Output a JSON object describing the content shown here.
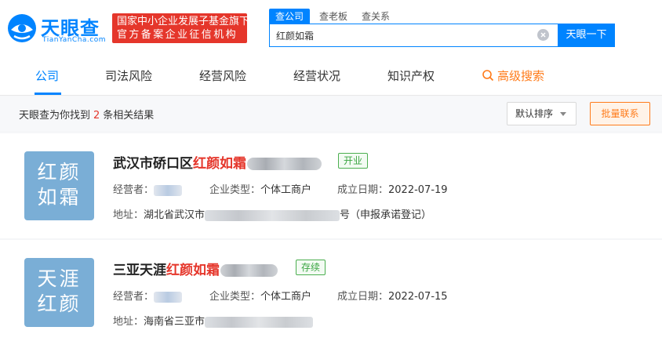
{
  "header": {
    "logo_cn": "天眼查",
    "logo_en": "TianYanCha.com",
    "badge_line1": "国家中小企业发展子基金旗下",
    "badge_line2": "官方备案企业征信机构",
    "search_tabs": [
      "查公司",
      "查老板",
      "查关系"
    ],
    "search_value": "红颜如霜",
    "search_button": "天眼一下"
  },
  "nav": {
    "items": [
      "公司",
      "司法风险",
      "经营风险",
      "经营状况",
      "知识产权"
    ],
    "advanced": "高级搜索"
  },
  "results": {
    "prefix": "天眼查为你找到",
    "count": "2",
    "suffix": "条相关结果",
    "sort_label": "默认排序",
    "batch_label": "批量联系"
  },
  "companies": [
    {
      "avatar_line1": "红颜",
      "avatar_line2": "如霜",
      "name_prefix": "武汉市硚口区",
      "name_highlight": "红颜如霜",
      "status": "开业",
      "operator_label": "经营者：",
      "type_label": "企业类型：",
      "type_value": "个体工商户",
      "date_label": "成立日期：",
      "date_value": "2022-07-19",
      "address_label": "地址：",
      "address_value": "湖北省武汉市",
      "address_suffix": "号（申报承诺登记）"
    },
    {
      "avatar_line1": "天涯",
      "avatar_line2": "红颜",
      "name_prefix": "三亚天涯",
      "name_highlight": "红颜如霜",
      "status": "存续",
      "operator_label": "经营者：",
      "type_label": "企业类型：",
      "type_value": "个体工商户",
      "date_label": "成立日期：",
      "date_value": "2022-07-15",
      "address_label": "地址：",
      "address_value": "海南省三亚市",
      "address_suffix": ""
    }
  ]
}
